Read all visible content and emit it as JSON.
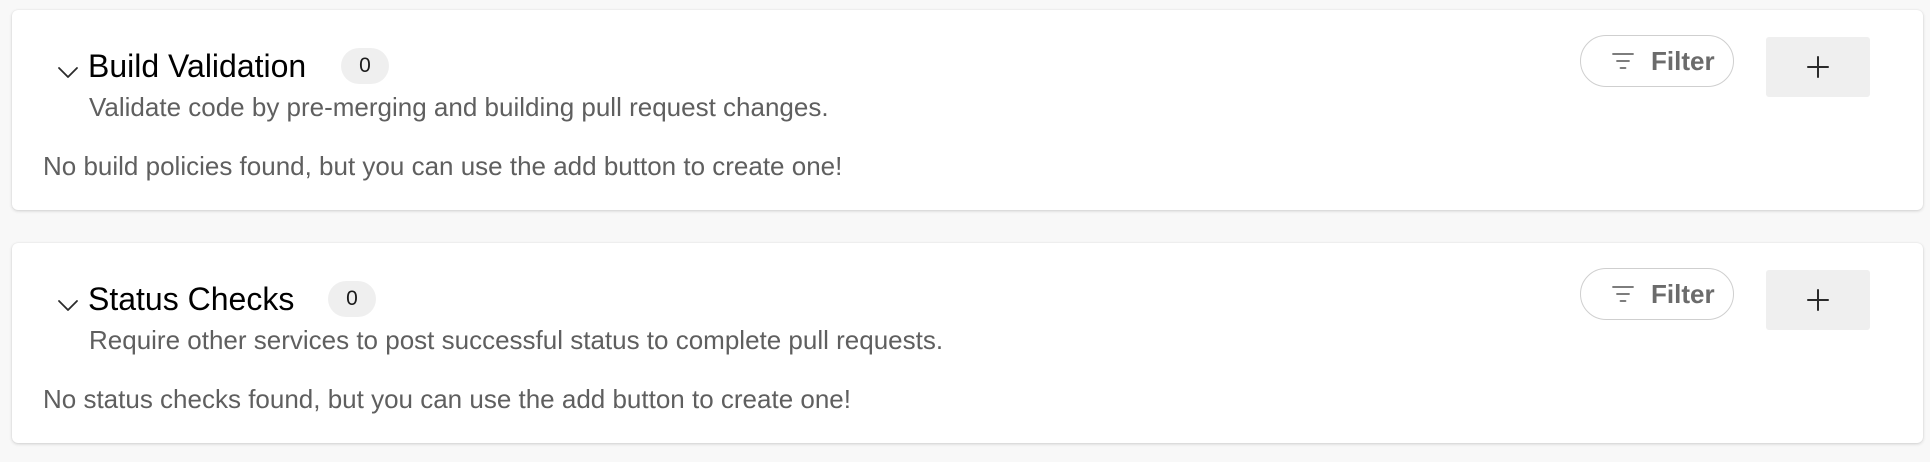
{
  "sections": [
    {
      "title": "Build Validation",
      "count": "0",
      "description": "Validate code by pre-merging and building pull request changes.",
      "empty_message": "No build policies found, but you can use the add button to create one!",
      "filter_label": "Filter",
      "add_icon": "plus-icon"
    },
    {
      "title": "Status Checks",
      "count": "0",
      "description": "Require other services to post successful status to complete pull requests.",
      "empty_message": "No status checks found, but you can use the add button to create one!",
      "filter_label": "Filter",
      "add_icon": "plus-icon"
    }
  ],
  "colors": {
    "page_background": "#f8f8f8",
    "card_background": "#ffffff",
    "secondary_text": "#5f5f5f",
    "badge_background": "#efefef",
    "add_button_background": "#efefef"
  }
}
